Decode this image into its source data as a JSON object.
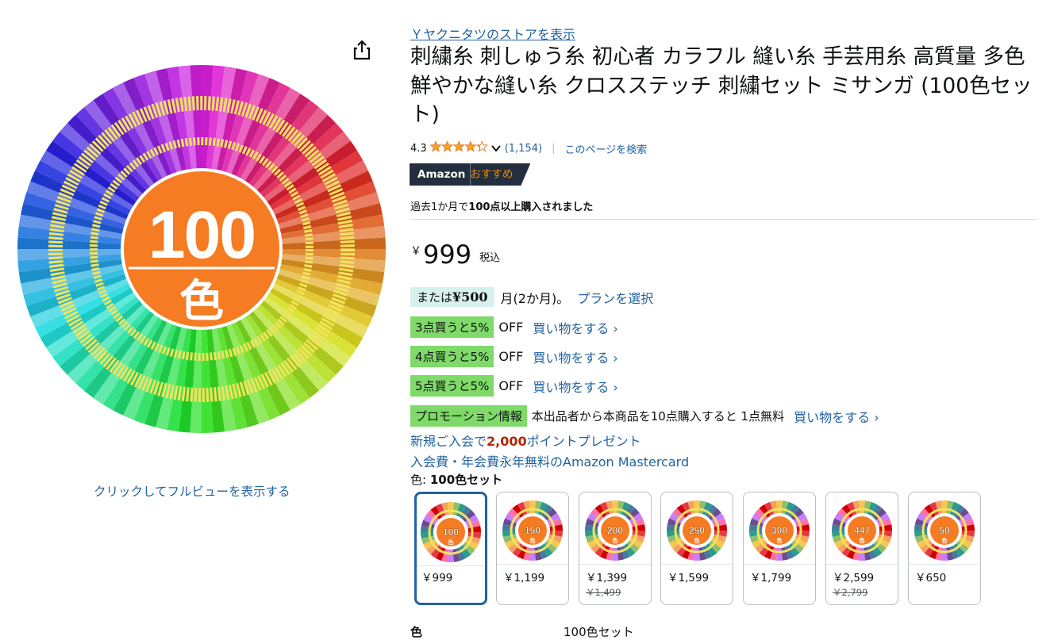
{
  "store_link": "Ｙヤクニタツのストアを表示",
  "title": "刺繍糸 刺しゅう糸 初心者 カラフル 縫い糸 手芸用糸 高質量 多色鮮やかな縫い糸 クロスステッチ 刺繍セット ミサンガ (100色セット)",
  "rating": {
    "value": "4.3",
    "stars": 4.3,
    "count": "(1,154)",
    "search_page": "このページを検索"
  },
  "badge": {
    "brand": "Amazon",
    "label": "おすすめ"
  },
  "bought": {
    "prefix": "過去1か月で",
    "bold": "100点以上購入されました"
  },
  "price": {
    "symbol": "￥",
    "amount": "999",
    "tax": "税込"
  },
  "installment": {
    "prefix": "または",
    "amount": "¥500",
    "suffix": "月(2か月)。",
    "link": "プランを選択"
  },
  "bulk_offers": [
    {
      "label": "3点買うと5%",
      "off": "OFF",
      "link": "買い物をする ›"
    },
    {
      "label": "4点買うと5%",
      "off": "OFF",
      "link": "買い物をする ›"
    },
    {
      "label": "5点買うと5%",
      "off": "OFF",
      "link": "買い物をする ›"
    }
  ],
  "promotion": {
    "label": "プロモーション情報",
    "text": "本出品者から本商品を10点購入すると 1点無料",
    "link": "買い物をする ›"
  },
  "points": {
    "prefix": "新規ご入会で",
    "amount": "2,000",
    "suffix": "ポイントプレゼント"
  },
  "card": "入会費・年会費永年無料のAmazon Mastercard",
  "color": {
    "label": "色:",
    "value": "100色セット"
  },
  "hero": {
    "number": "100",
    "unit": "色"
  },
  "full_view": "クリックしてフルビューを表示する",
  "swatches": [
    {
      "n": "100",
      "price": "￥999",
      "old": ""
    },
    {
      "n": "150",
      "price": "￥1,199",
      "old": ""
    },
    {
      "n": "200",
      "price": "￥1,399",
      "old": "￥1,499"
    },
    {
      "n": "250",
      "price": "￥1,599",
      "old": ""
    },
    {
      "n": "300",
      "price": "￥1,799",
      "old": ""
    },
    {
      "n": "447",
      "price": "￥2,599",
      "old": "￥2,799"
    },
    {
      "n": "50",
      "price": "￥650",
      "old": ""
    }
  ],
  "spec": {
    "key": "色",
    "value": "100色セット"
  },
  "colors": {
    "link": "#2162a1",
    "price_red": "#b12704",
    "badge_bg": "#232f3e",
    "badge_orange": "#f08804",
    "green": "#7fda69",
    "teal": "#d7f1ee",
    "orange_disc": "#f57c22",
    "star": "#ffa41c"
  }
}
